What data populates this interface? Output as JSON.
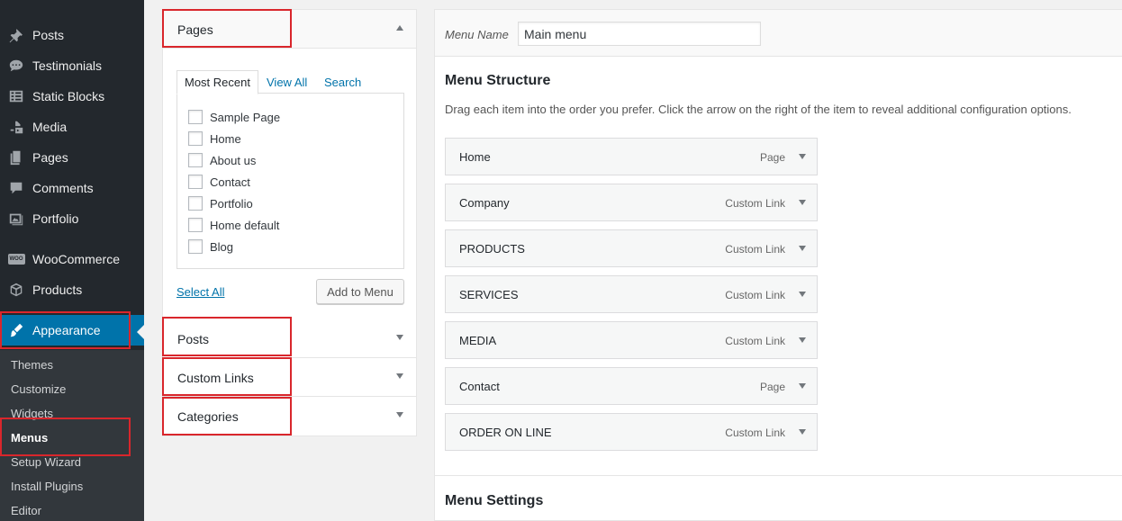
{
  "sidebar": {
    "items": [
      {
        "label": "Posts",
        "icon": "pin-icon"
      },
      {
        "label": "Testimonials",
        "icon": "speech-bubble-icon"
      },
      {
        "label": "Static Blocks",
        "icon": "table-icon"
      },
      {
        "label": "Media",
        "icon": "media-icon"
      },
      {
        "label": "Pages",
        "icon": "pages-icon"
      },
      {
        "label": "Comments",
        "icon": "comment-icon"
      },
      {
        "label": "Portfolio",
        "icon": "portfolio-icon"
      },
      {
        "label": "WooCommerce",
        "icon": "woo-icon"
      },
      {
        "label": "Products",
        "icon": "box-icon"
      },
      {
        "label": "Appearance",
        "icon": "paintbrush-icon"
      }
    ],
    "submenu": [
      "Themes",
      "Customize",
      "Widgets",
      "Menus",
      "Setup Wizard",
      "Install Plugins",
      "Editor"
    ],
    "woo_badge": "WOO"
  },
  "accordion": {
    "pages_title": "Pages",
    "tabs": [
      "Most Recent",
      "View All",
      "Search"
    ],
    "pages": [
      "Sample Page",
      "Home",
      "About us",
      "Contact",
      "Portfolio",
      "Home default",
      "Blog"
    ],
    "select_all": "Select All",
    "add_to_menu": "Add to Menu",
    "sections": [
      "Posts",
      "Custom Links",
      "Categories"
    ]
  },
  "menu": {
    "name_label": "Menu Name",
    "name_value": "Main menu",
    "structure_title": "Menu Structure",
    "instructions": "Drag each item into the order you prefer. Click the arrow on the right of the item to reveal additional configuration options.",
    "items": [
      {
        "title": "Home",
        "type": "Page"
      },
      {
        "title": "Company",
        "type": "Custom Link"
      },
      {
        "title": "PRODUCTS",
        "type": "Custom Link"
      },
      {
        "title": "SERVICES",
        "type": "Custom Link"
      },
      {
        "title": "MEDIA",
        "type": "Custom Link"
      },
      {
        "title": "Contact",
        "type": "Page"
      },
      {
        "title": "ORDER ON LINE",
        "type": "Custom Link"
      }
    ],
    "settings_title": "Menu Settings"
  },
  "colors": {
    "sidebar_bg": "#23282d",
    "active_bg": "#0073aa",
    "highlight_red": "#d9262c",
    "link_blue": "#0073aa"
  }
}
